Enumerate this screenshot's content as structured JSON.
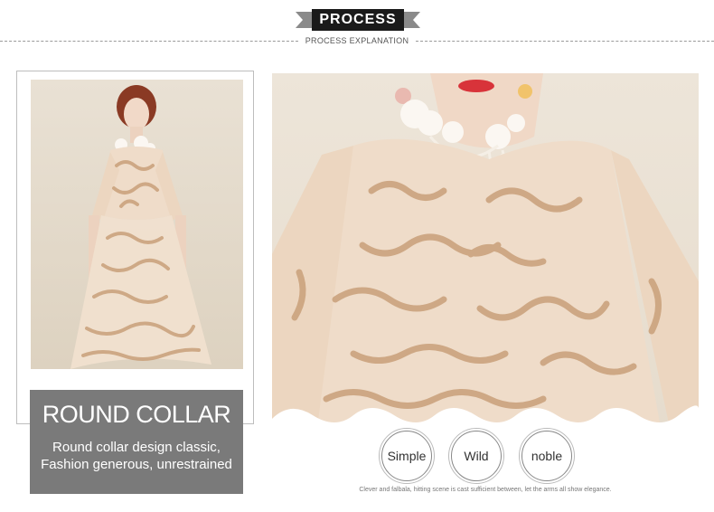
{
  "header": {
    "title": "PROCESS",
    "subtitle": "PROCESS EXPLANATION"
  },
  "feature": {
    "title": "ROUND COLLAR",
    "desc_line1": "Round collar design classic,",
    "desc_line2": "Fashion generous, unrestrained"
  },
  "tags": [
    {
      "label": "Simple"
    },
    {
      "label": "Wild"
    },
    {
      "label": "noble"
    }
  ],
  "footnote": "Clever and falbala, hitting scene is cast sufficient between, let the arms all show elegance.",
  "colors": {
    "ribbon": "#1a1a1a",
    "dress": "#efdcc9",
    "embroidery": "#c9a07a",
    "caption_box": "#7a7a7a",
    "background": "#ffffff"
  }
}
